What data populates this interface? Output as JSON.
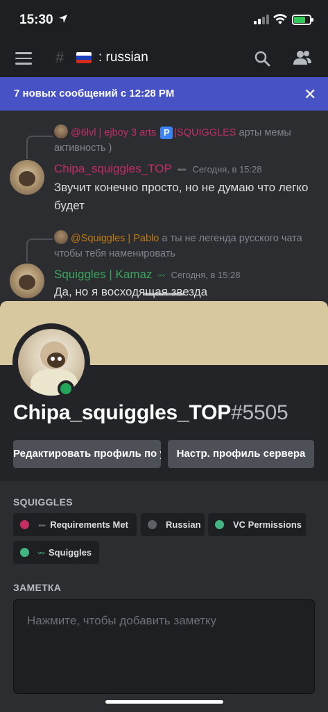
{
  "status_bar": {
    "time": "15:30",
    "icons": [
      "location-arrow-icon",
      "signal-icon",
      "wifi-icon",
      "battery-charging-icon"
    ]
  },
  "header": {
    "channel_prefix_icon": "hash-icon",
    "channel_name": ": russian",
    "icons": [
      "menu-icon",
      "search-icon",
      "members-icon"
    ]
  },
  "new_messages_bar": {
    "text": "7 новых сообщений с 12:28 PM",
    "close": "✕"
  },
  "messages": [
    {
      "reply": {
        "author": "@6lvl | ejboy 3 arts",
        "badge": "P",
        "author_suffix": "|SQUIGGLES",
        "text": " арты мемы активность )"
      },
      "author": "Chipa_squiggles_TOP",
      "tag": "➖",
      "timestamp": "Сегодня, в 15:28",
      "body": "Звучит конечно просто, но не думаю что легко будет"
    },
    {
      "reply": {
        "author": "@Squiggles | Pablo",
        "text": " а ты не легенда русского чата чтобы тебя наменировать"
      },
      "author": "Squiggles | Kamaz",
      "tag": "〰",
      "timestamp": "Сегодня, в 15:28",
      "body": "Да, но я восходящая звезда"
    }
  ],
  "profile": {
    "name": "Chipa_squiggles_TOP",
    "discriminator": "#5505",
    "status": "online",
    "banner_color": "#d8c8a0",
    "buttons": {
      "edit_profile": "Редактировать профиль по у",
      "server_profile": "Настр. профиль сервера"
    },
    "roles_title": "SQUIGGLES",
    "roles": [
      {
        "label": "Requirements Met",
        "color": "#c42e61",
        "mini": "➖"
      },
      {
        "label": "Russian",
        "color": "#5c5f66",
        "mini": ""
      },
      {
        "label": "VC Permissions",
        "color": "#43b581",
        "mini": ""
      },
      {
        "label": "Squiggles",
        "color": "#43b581",
        "mini": "〰"
      }
    ],
    "note_title": "ЗАМЕТКА",
    "note_placeholder": "Нажмите, чтобы добавить заметку"
  },
  "colors": {
    "accent": "#4752c4",
    "online": "#23a559"
  }
}
